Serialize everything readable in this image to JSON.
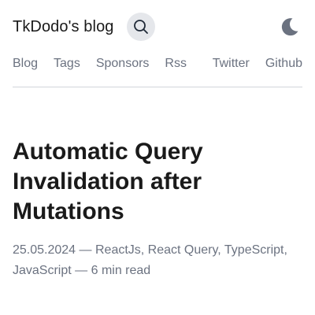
{
  "header": {
    "site_title": "TkDodo's blog",
    "search_icon": "search-icon",
    "theme_icon": "moon-icon"
  },
  "nav": {
    "items": [
      {
        "label": "Blog"
      },
      {
        "label": "Tags"
      },
      {
        "label": "Sponsors"
      },
      {
        "label": "Rss"
      },
      {
        "label": "Twitter"
      },
      {
        "label": "Github"
      }
    ]
  },
  "post": {
    "title": "Automatic Query Invalidation after Mutations",
    "date": "25.05.2024",
    "separator": "—",
    "tags": [
      "ReactJs",
      "React Query",
      "TypeScript",
      "JavaScript"
    ],
    "read_time": "6 min read"
  },
  "colors": {
    "text": "#1a1a1a",
    "muted": "#6b7280",
    "search_bg": "#e5e7eb",
    "moon": "#6b7280",
    "divider": "#d1d5db"
  }
}
